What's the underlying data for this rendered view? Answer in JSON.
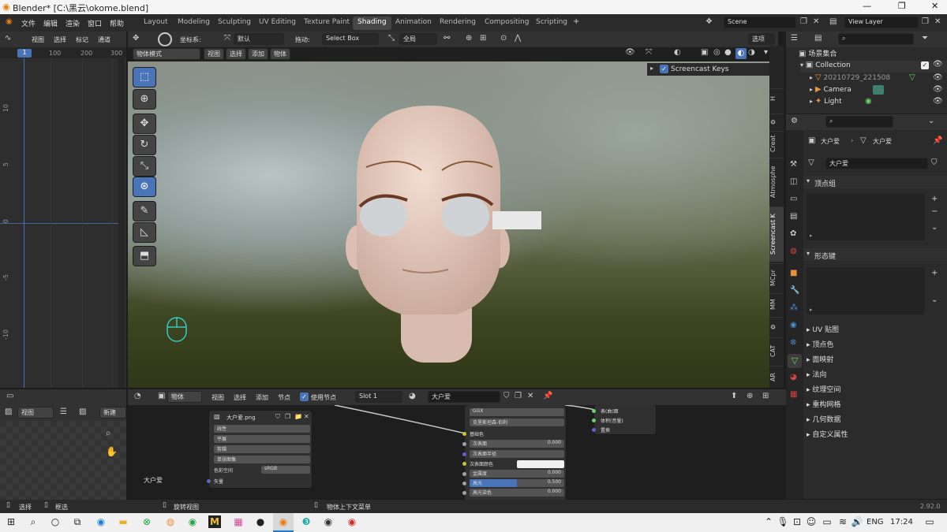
{
  "window": {
    "title": "Blender* [C:\\黑云\\okome.blend]"
  },
  "menu": {
    "items": [
      "文件",
      "编辑",
      "渲染",
      "窗口",
      "帮助"
    ],
    "active_ws": "Shading",
    "workspaces": [
      "Layout",
      "Modeling",
      "Sculpting",
      "UV Editing",
      "Texture Paint",
      "Shading",
      "Animation",
      "Rendering",
      "Compositing",
      "Scripting"
    ],
    "scene": "Scene",
    "view_layer": "View Layer"
  },
  "ruler": {
    "header": [
      "视图",
      "选择",
      "标记",
      "通道"
    ],
    "frame": "1",
    "x_ticks": [
      "100",
      "200",
      "300"
    ],
    "y_ticks": [
      "10",
      "5",
      "0",
      "-5",
      "-10"
    ]
  },
  "vp_header": {
    "coord_label": "坐标系:",
    "coord_value": "默认",
    "drag_label": "拖动:",
    "drag_value": "Select Box",
    "pivot": "全局",
    "mode": "物体模式",
    "menus": [
      "视图",
      "选择",
      "添加",
      "物体"
    ],
    "options": "选项"
  },
  "screencast": {
    "label": "Screencast Keys"
  },
  "side_tabs": [
    "Creat",
    "Atmosphe",
    "Screencast K",
    "MCpr",
    "MM",
    "CAT",
    "AR"
  ],
  "outliner": {
    "root": "场景集合",
    "collection": "Collection",
    "items": [
      "20210729_221508",
      "Camera",
      "Light"
    ]
  },
  "props": {
    "object": "大户爱",
    "mesh": "大户爱",
    "data_name": "大户爱",
    "sections_open": [
      "顶点组",
      "形态键"
    ],
    "sections": [
      "UV 贴图",
      "顶点色",
      "面映射",
      "法向",
      "纹理空间",
      "重构网格",
      "几何数据",
      "自定义属性"
    ]
  },
  "image_editor": {
    "view": "视图",
    "new": "新建"
  },
  "node_header": {
    "object": "物体",
    "menus": [
      "视图",
      "选择",
      "添加",
      "节点"
    ],
    "use_nodes": "使用节点",
    "slot": "Slot 1",
    "material": "大户爱"
  },
  "image_node": {
    "file": "大户爱.png",
    "rows": [
      "线性",
      "平展",
      "剪辑",
      "单张图像"
    ],
    "colorspace_label": "色彩空间",
    "colorspace": "sRGB",
    "vector": "矢量"
  },
  "bsdf": {
    "dist": "GGX",
    "sss": "克里斯坦森-伯利",
    "base": "基础色",
    "fields": [
      {
        "label": "次表面",
        "value": "0.000"
      },
      {
        "label": "次表面半径",
        "value": ""
      },
      {
        "label": "次表面颜色",
        "value": ""
      },
      {
        "label": "金属度",
        "value": "0.000"
      },
      {
        "label": "高光",
        "value": "0.500"
      },
      {
        "label": "高光染色",
        "value": "0.000"
      }
    ],
    "specular_fill": 0.5
  },
  "output_node": {
    "rows": [
      "表(曲)面",
      "体积(音量)",
      "置换"
    ]
  },
  "node_label": "大户爱",
  "status": {
    "select": "选择",
    "box": "框选",
    "rotate": "旋转视图",
    "context": "物体上下文菜单",
    "version": "2.92.0"
  },
  "taskbar": {
    "lang": "ENG",
    "time": "17:24"
  }
}
